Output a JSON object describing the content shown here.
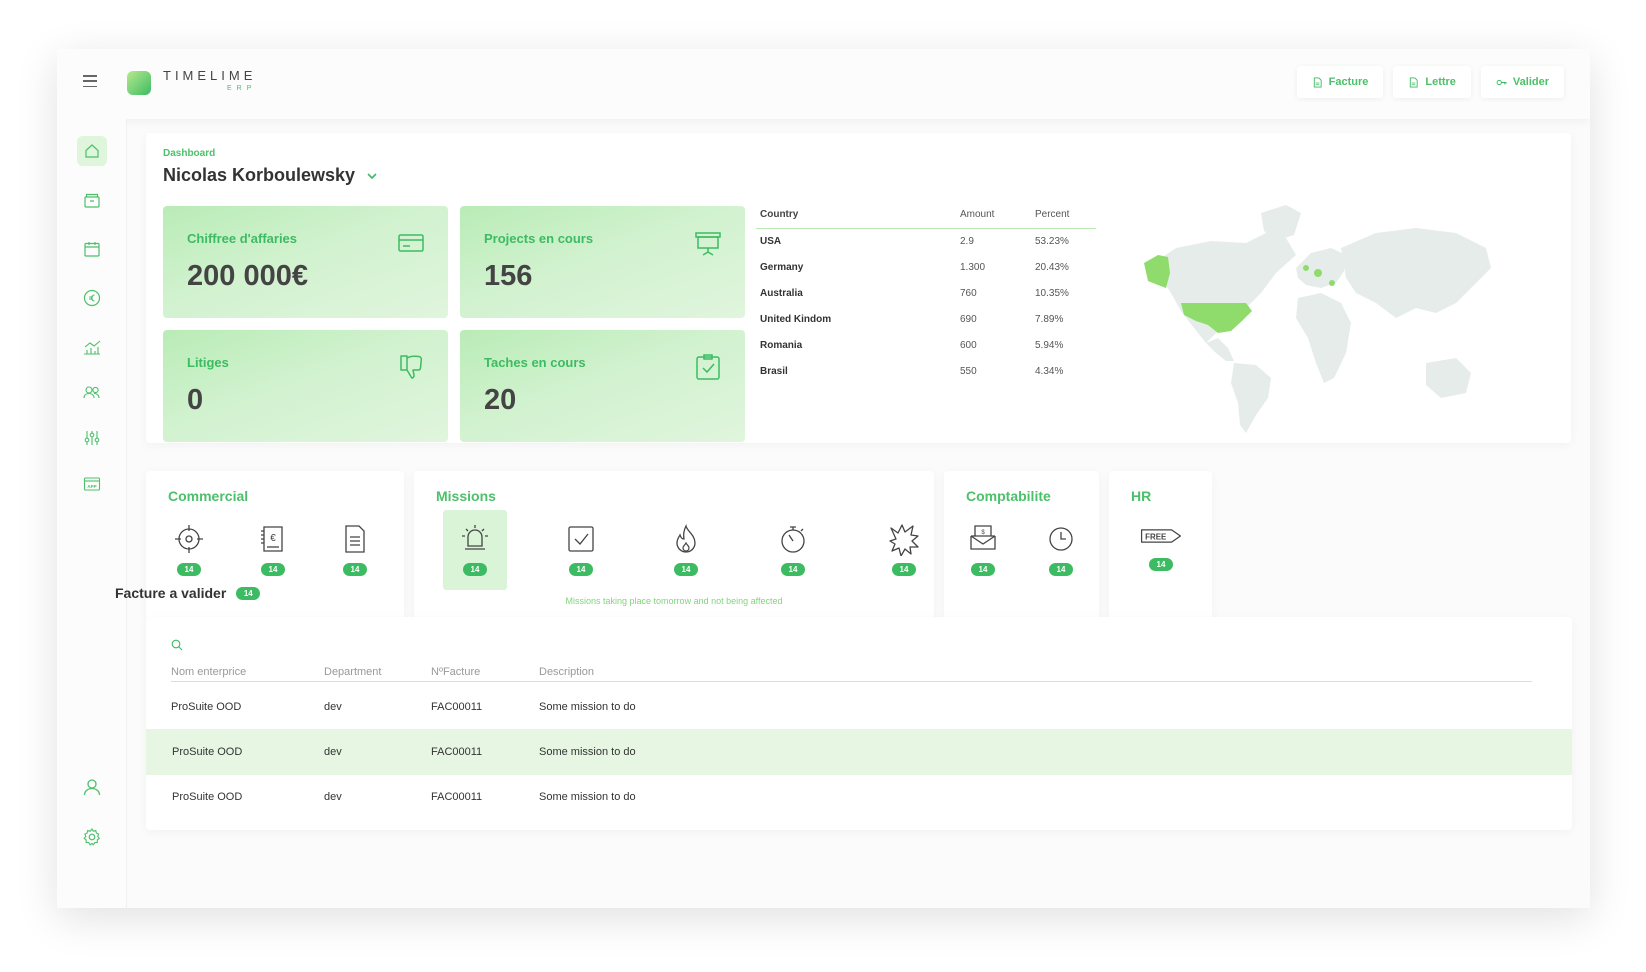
{
  "app": {
    "logo_text": "TIMELIME",
    "logo_sub": "ERP"
  },
  "top_actions": [
    {
      "label": "Facture",
      "icon": "document-icon"
    },
    {
      "label": "Lettre",
      "icon": "document-icon"
    },
    {
      "label": "Valider",
      "icon": "key-icon"
    }
  ],
  "sidebar": {
    "items": [
      "home-icon",
      "archive-icon",
      "calendar-icon",
      "euro-icon",
      "chart-icon",
      "users-icon",
      "sliders-icon",
      "app-icon"
    ],
    "bottom": [
      "user-icon",
      "gear-icon"
    ]
  },
  "header": {
    "breadcrumb": "Dashboard",
    "user_name": "Nicolas Korboulewsky"
  },
  "stats": [
    {
      "label": "Chiffree d'affaries",
      "value": "200 000€",
      "icon": "credit-card-icon"
    },
    {
      "label": "Projects en cours",
      "value": "156",
      "icon": "presentation-icon"
    },
    {
      "label": "Litiges",
      "value": "0",
      "icon": "thumbs-down-icon"
    },
    {
      "label": "Taches en cours",
      "value": "20",
      "icon": "clipboard-check-icon"
    }
  ],
  "country_table": {
    "headers": [
      "Country",
      "Amount",
      "Percent"
    ],
    "rows": [
      [
        "USA",
        "2.9",
        "53.23%"
      ],
      [
        "Germany",
        "1.300",
        "20.43%"
      ],
      [
        "Australia",
        "760",
        "10.35%"
      ],
      [
        "United Kindom",
        "690",
        "7.89%"
      ],
      [
        "Romania",
        "600",
        "5.94%"
      ],
      [
        "Brasil",
        "550",
        "4.34%"
      ]
    ]
  },
  "modules": {
    "commercial": {
      "title": "Commercial",
      "items": [
        {
          "icon": "target-icon",
          "count": "14"
        },
        {
          "icon": "euro-invoice-icon",
          "count": "14"
        },
        {
          "icon": "file-icon",
          "count": "14"
        }
      ]
    },
    "missions": {
      "title": "Missions",
      "note": "Missions taking place tomorrow and not being affected",
      "items": [
        {
          "icon": "alarm-icon",
          "count": "14"
        },
        {
          "icon": "checkbox-icon",
          "count": "14"
        },
        {
          "icon": "flame-icon",
          "count": "14"
        },
        {
          "icon": "stopwatch-icon",
          "count": "14"
        },
        {
          "icon": "burst-icon",
          "count": "14"
        }
      ]
    },
    "comptabilite": {
      "title": "Comptabilite",
      "items": [
        {
          "icon": "bill-icon",
          "count": "14"
        },
        {
          "icon": "clock-icon",
          "count": "14"
        }
      ]
    },
    "hr": {
      "title": "HR",
      "items": [
        {
          "icon": "free-tag-icon",
          "count": "14",
          "label": "FREE"
        }
      ]
    }
  },
  "invoices": {
    "title": "Facture a valider",
    "count": "14",
    "headers": [
      "Nom enterprice",
      "Department",
      "NºFacture",
      "Description"
    ],
    "rows": [
      [
        "ProSuite OOD",
        "dev",
        "FAC00011",
        "Some mission to do"
      ],
      [
        "ProSuite OOD",
        "dev",
        "FAC00011",
        "Some mission to do"
      ],
      [
        "ProSuite OOD",
        "dev",
        "FAC00011",
        "Some mission to do"
      ]
    ]
  },
  "colors": {
    "accent": "#3dbb63",
    "accent_light": "#dff5dc",
    "map_land": "#e6ece9",
    "map_highlight": "#8fdc6c"
  }
}
